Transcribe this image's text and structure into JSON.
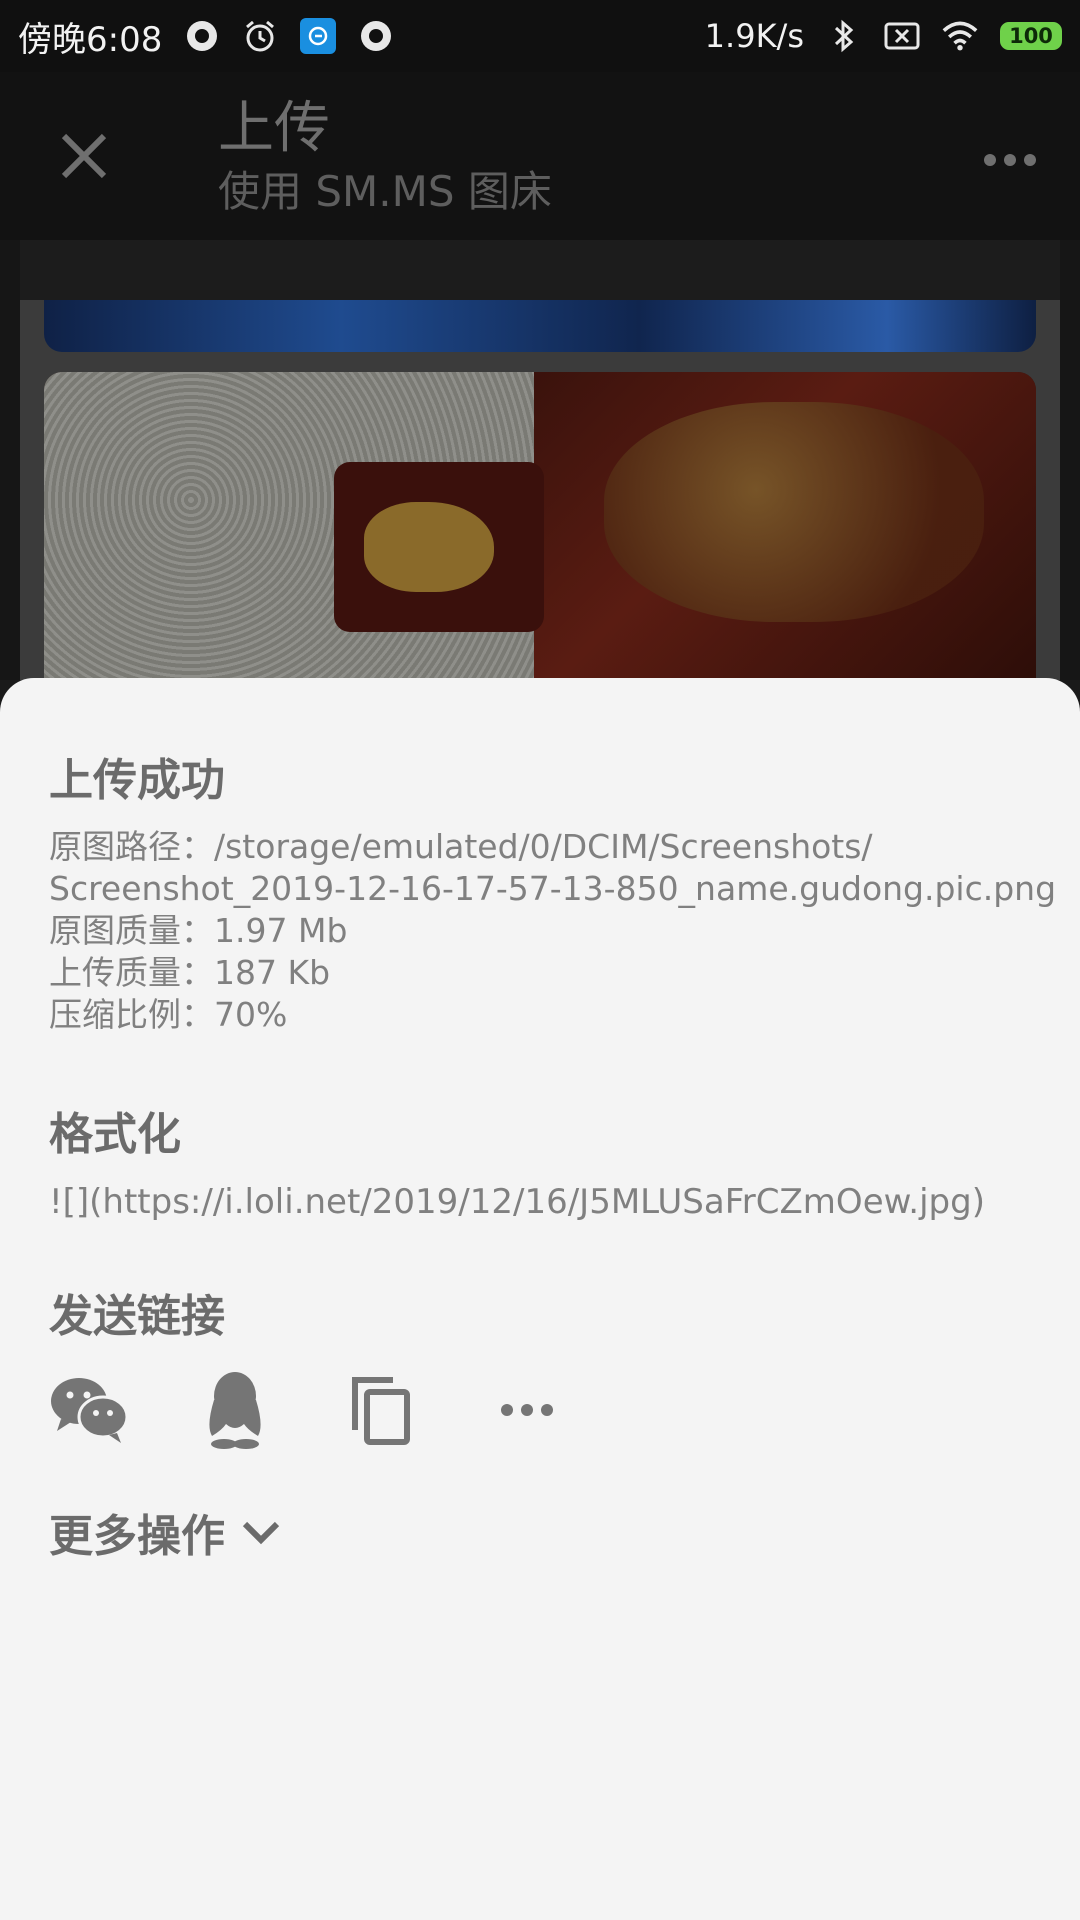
{
  "status_bar": {
    "time": "傍晚6:08",
    "network_speed": "1.9K/s",
    "battery_level": "100",
    "colors": {
      "battery": "#6fd14a",
      "app_icon": "#1a8fe0"
    }
  },
  "app_bar": {
    "title": "上传",
    "subtitle": "使用 SM.MS 图床"
  },
  "sheet": {
    "success_title": "上传成功",
    "info": {
      "path_line1": "原图路径：/storage/emulated/0/DCIM/Screenshots/",
      "path_line2": "Screenshot_2019-12-16-17-57-13-850_name.gudong.pic.png",
      "original_size": "原图质量：1.97 Mb",
      "uploaded_size": "上传质量：187 Kb",
      "compression": "压缩比例：70%"
    },
    "format_title": "格式化",
    "format_value": "![](https://i.loli.net/2019/12/16/J5MLUSaFrCZmOew.jpg)",
    "send_title": "发送链接",
    "share_targets": [
      "wechat-icon",
      "qq-icon",
      "copy-icon",
      "more-icon"
    ],
    "more_actions": "更多操作"
  }
}
